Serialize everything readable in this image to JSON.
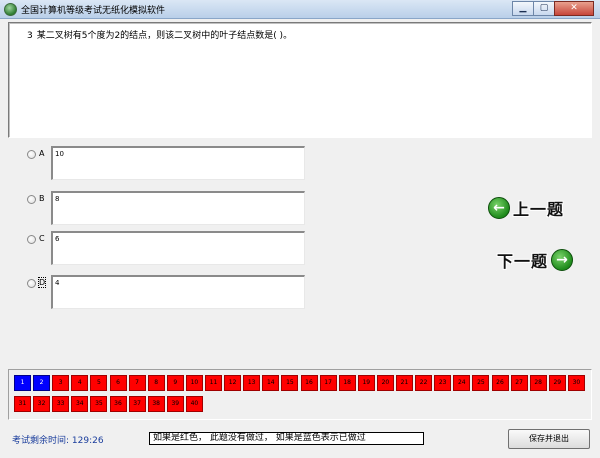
{
  "window": {
    "title": "全国计算机等级考试无纸化模拟软件",
    "min_glyph": "▁",
    "max_glyph": "▢",
    "close_glyph": "✕"
  },
  "question": {
    "number": "3",
    "text": "某二叉树有5个度为2的结点，则该二叉树中的叶子结点数是(     )。"
  },
  "options": [
    {
      "letter": "A",
      "text": "10"
    },
    {
      "letter": "B",
      "text": "8"
    },
    {
      "letter": "C",
      "text": "6"
    },
    {
      "letter": "D",
      "text": "4"
    }
  ],
  "nav": {
    "prev_label": "上一题",
    "next_label": "下一题",
    "prev_icon": "←",
    "next_icon": "→"
  },
  "answer_sheet": {
    "questions": [
      {
        "n": "1",
        "status": "answered"
      },
      {
        "n": "2",
        "status": "answered"
      },
      {
        "n": "3",
        "status": "unanswered"
      },
      {
        "n": "4",
        "status": "unanswered"
      },
      {
        "n": "5",
        "status": "unanswered"
      },
      {
        "n": "6",
        "status": "unanswered"
      },
      {
        "n": "7",
        "status": "unanswered"
      },
      {
        "n": "8",
        "status": "unanswered"
      },
      {
        "n": "9",
        "status": "unanswered"
      },
      {
        "n": "10",
        "status": "unanswered"
      },
      {
        "n": "11",
        "status": "unanswered"
      },
      {
        "n": "12",
        "status": "unanswered"
      },
      {
        "n": "13",
        "status": "unanswered"
      },
      {
        "n": "14",
        "status": "unanswered"
      },
      {
        "n": "15",
        "status": "unanswered"
      },
      {
        "n": "16",
        "status": "unanswered"
      },
      {
        "n": "17",
        "status": "unanswered"
      },
      {
        "n": "18",
        "status": "unanswered"
      },
      {
        "n": "19",
        "status": "unanswered"
      },
      {
        "n": "20",
        "status": "unanswered"
      },
      {
        "n": "21",
        "status": "unanswered"
      },
      {
        "n": "22",
        "status": "unanswered"
      },
      {
        "n": "23",
        "status": "unanswered"
      },
      {
        "n": "24",
        "status": "unanswered"
      },
      {
        "n": "25",
        "status": "unanswered"
      },
      {
        "n": "26",
        "status": "unanswered"
      },
      {
        "n": "27",
        "status": "unanswered"
      },
      {
        "n": "28",
        "status": "unanswered"
      },
      {
        "n": "29",
        "status": "unanswered"
      },
      {
        "n": "30",
        "status": "unanswered"
      },
      {
        "n": "31",
        "status": "unanswered"
      },
      {
        "n": "32",
        "status": "unanswered"
      },
      {
        "n": "33",
        "status": "unanswered"
      },
      {
        "n": "34",
        "status": "unanswered"
      },
      {
        "n": "35",
        "status": "unanswered"
      },
      {
        "n": "36",
        "status": "unanswered"
      },
      {
        "n": "37",
        "status": "unanswered"
      },
      {
        "n": "38",
        "status": "unanswered"
      },
      {
        "n": "39",
        "status": "unanswered"
      },
      {
        "n": "40",
        "status": "unanswered"
      }
    ],
    "answered_color": "#0000ff",
    "unanswered_color": "#ff0000"
  },
  "footer": {
    "timer_label": "考试剩余时间: ",
    "timer_value": "129:26",
    "hint": "如果是红色， 此题没有做过， 如果是蓝色表示已做过",
    "save_label": "保存并退出"
  }
}
